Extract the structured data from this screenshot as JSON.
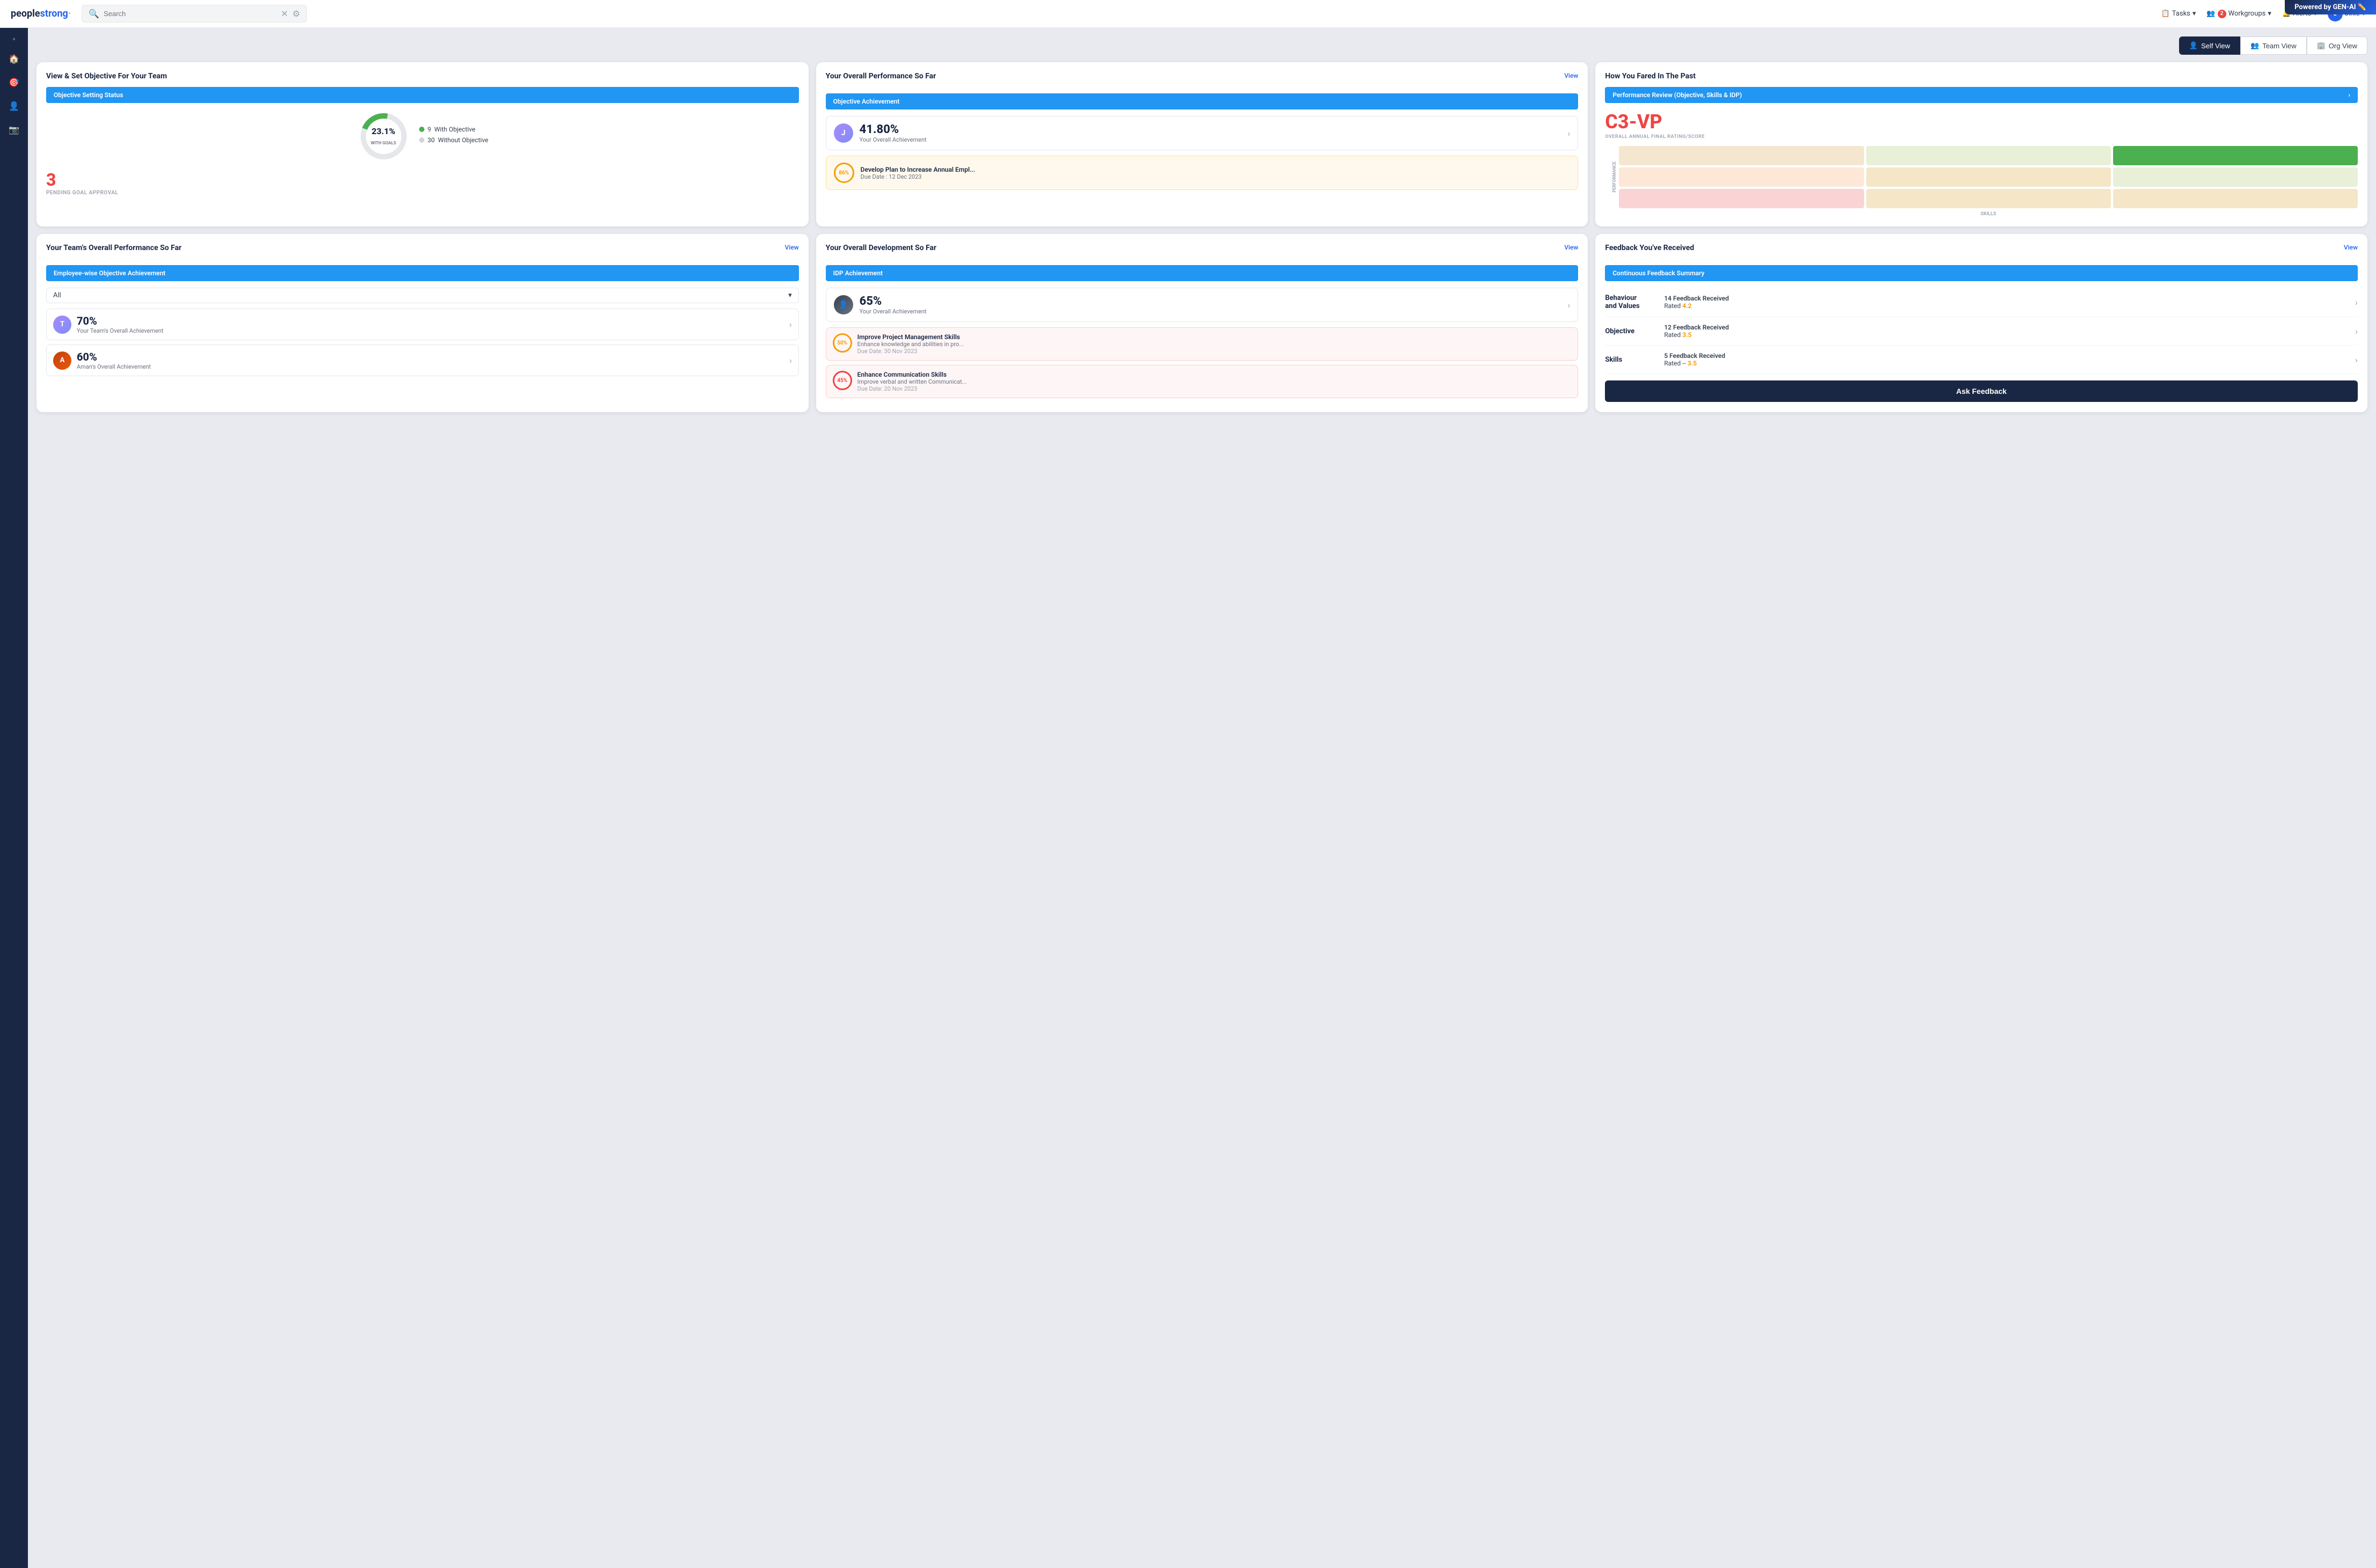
{
  "genai_banner": "Powered by GEN-AI ✏️",
  "navbar": {
    "logo_text": "peoplestrong",
    "logo_dot": "·",
    "search_placeholder": "Search",
    "tasks_label": "Tasks",
    "workgroups_label": "Workgroups",
    "workgroups_badge": "2",
    "alerts_label": "Alerts",
    "user_label": "Jinie"
  },
  "views": {
    "self": "Self View",
    "team": "Team View",
    "org": "Org View",
    "active": "Self View"
  },
  "card1": {
    "title": "View & Set Objective For Your Team",
    "section_label": "Objective Setting Status",
    "donut_percent": "23.1%",
    "donut_sub": "WITH GOALS",
    "with_objective_count": "9",
    "with_objective_label": "With Objective",
    "without_objective_count": "30",
    "without_objective_label": "Without Objective",
    "pending_number": "3",
    "pending_label": "PENDING GOAL APPROVAL"
  },
  "card2": {
    "title": "Your Overall Performance So Far",
    "view_link": "View",
    "section_label": "Objective Achievement",
    "achievement_pct": "41.80%",
    "achievement_sub": "Your Overall Achievement",
    "goal_progress": "86%",
    "goal_title": "Develop Plan to Increase Annual Empl...",
    "goal_due": "Due Date : 12 Dec 2023"
  },
  "card3": {
    "title": "How You Fared In The Past",
    "section_label": "Performance Review (Objective, Skills & IDP)",
    "rating_score": "C3-VP",
    "rating_label": "OVERALL ANNUAL FINAL RATING/SCORE",
    "perf_label": "PERFORMANCE",
    "skills_label": "SKILLS",
    "matrix": {
      "rows": [
        [
          "#f5e6d0",
          "#e8f0d8",
          "#4caf50"
        ],
        [
          "#fde8d8",
          "#f5e6c8",
          "#e8f0d8"
        ],
        [
          "#fad4d4",
          "#f5e6c8",
          "#f5e6c8"
        ]
      ]
    }
  },
  "card4": {
    "title": "Your Team's Overall Performance So Far",
    "view_link": "View",
    "section_label": "Employee-wise Objective Achievement",
    "dropdown_value": "All",
    "rows": [
      {
        "pct": "70%",
        "sub": "Your Team's Overall Achievement",
        "avatar_color": "#6b7280"
      },
      {
        "pct": "60%",
        "sub": "Aman's Overall Achievement",
        "avatar_color": "#c2410c"
      }
    ]
  },
  "card5": {
    "title": "Your Overall Development So Far",
    "view_link": "View",
    "section_label": "IDP Achievement",
    "achievement_pct": "65%",
    "achievement_sub": "Your Overall Achievement",
    "goals": [
      {
        "progress": "50%",
        "title": "Improve Project Management Skills",
        "sub": "Enhance knowledge and abilities in pro...",
        "due": "Due Date: 30 Nov 2023",
        "progress_color": "#f59e0b"
      },
      {
        "progress": "45%",
        "title": "Enhance Communication Skills",
        "sub": "Improve verbal and written Communicat...",
        "due": "Due Date: 20 Nov 2023",
        "progress_color": "#ef4444"
      }
    ]
  },
  "card6": {
    "title": "Feedback You've Received",
    "view_link": "View",
    "section_label": "Continuous Feedback Summary",
    "rows": [
      {
        "type": "Behaviour\nand Values",
        "count": "14 Feedback Received",
        "rating_label": "Rated ",
        "rating_value": "4.2"
      },
      {
        "type": "Objective",
        "count": "12 Feedback Received",
        "rating_label": "Rated ",
        "rating_value": "3.5"
      },
      {
        "type": "Skills",
        "count": "5 Feedback Received",
        "rating_label": "Rated -- ",
        "rating_value": "3.5"
      }
    ],
    "ask_feedback_label": "Ask Feedback"
  }
}
